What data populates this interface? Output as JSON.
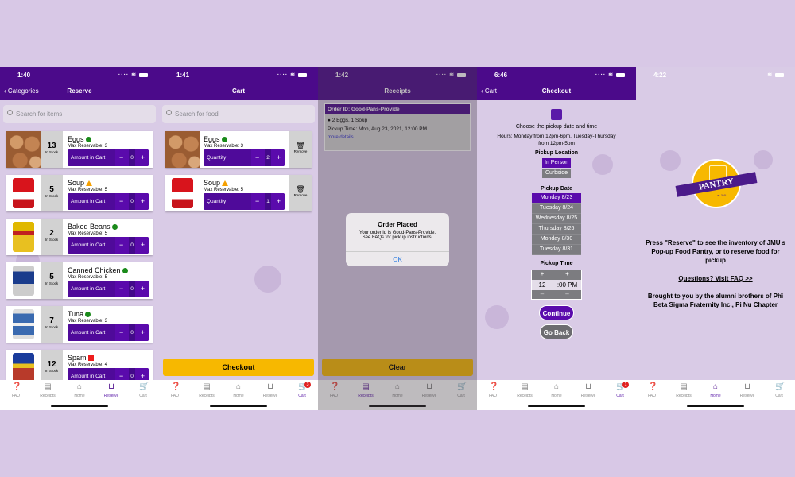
{
  "colors": {
    "brand": "#4b0a8a",
    "accent": "#f7b800",
    "background": "#d8c8e6",
    "available": "#1a8a1a",
    "low": "#f5a000",
    "out": "#ee1c1c"
  },
  "tabs": [
    {
      "label": "FAQ",
      "icon": "question-icon"
    },
    {
      "label": "Receipts",
      "icon": "receipt-icon"
    },
    {
      "label": "Home",
      "icon": "home-icon"
    },
    {
      "label": "Reserve",
      "icon": "basket-icon"
    },
    {
      "label": "Cart",
      "icon": "cart-icon"
    }
  ],
  "screen1": {
    "time": "1:40",
    "back": "Categories",
    "title": "Reserve",
    "search_placeholder": "Search for items",
    "stepper_label": "Amount in Cart",
    "in_stock_label": "In Stock",
    "items": [
      {
        "name": "Eggs",
        "stock": "13",
        "max": "Max Reservable: 3",
        "qty": "0",
        "status": "available"
      },
      {
        "name": "Soup",
        "stock": "5",
        "max": "Max Reservable: 5",
        "qty": "0",
        "status": "low"
      },
      {
        "name": "Baked Beans",
        "stock": "2",
        "max": "Max Reservable: 5",
        "qty": "0",
        "status": "available"
      },
      {
        "name": "Canned Chicken",
        "stock": "5",
        "max": "Max Reservable: 5",
        "qty": "0",
        "status": "available"
      },
      {
        "name": "Tuna",
        "stock": "7",
        "max": "Max Reservable: 3",
        "qty": "0",
        "status": "available"
      },
      {
        "name": "Spam",
        "stock": "12",
        "max": "Max Reservable: 4",
        "qty": "0",
        "status": "out"
      }
    ],
    "active_tab": "Reserve"
  },
  "screen2": {
    "time": "1:41",
    "title": "Cart",
    "search_placeholder": "Search for food",
    "stepper_label": "Quantity",
    "remove_label": "Remove",
    "items": [
      {
        "name": "Eggs",
        "max": "Max Reservable: 3",
        "qty": "2",
        "status": "available"
      },
      {
        "name": "Soup",
        "max": "Max Reservable: 5",
        "qty": "1",
        "status": "low"
      }
    ],
    "checkout_label": "Checkout",
    "cart_badge": "3",
    "active_tab": "Cart"
  },
  "screen3": {
    "time": "1:42",
    "title": "Receipts",
    "order_id": "Order ID: Good-Pans-Provide",
    "items": "2 Eggs, 1 Soup",
    "pickup": "Pickup Time:  Mon, Aug 23, 2021, 12:00 PM",
    "more": "more details...",
    "alert": {
      "title": "Order Placed",
      "line1": "Your order id is Good-Pans-Provide.",
      "line2": "See FAQs for pickup instructions.",
      "ok": "OK"
    },
    "clear_label": "Clear",
    "active_tab": "Receipts"
  },
  "screen4": {
    "time": "6:46",
    "back": "Cart",
    "title": "Checkout",
    "prompt": "Choose the pickup date and time",
    "hours1": "Hours: Monday from 12pm-6pm, Tuesday-Thursday",
    "hours2": "from 12pm-5pm",
    "location_label": "Pickup Location",
    "locations": [
      "In Person",
      "Curbside"
    ],
    "date_label": "Pickup Date",
    "dates": [
      "Monday 8/23",
      "Tuesday 8/24",
      "Wednesday 8/25",
      "Thursday 8/26",
      "Monday 8/30",
      "Tuesday 8/31"
    ],
    "time_label": "Pickup Time",
    "hour": "12",
    "minute": ":00 PM",
    "continue": "Continue",
    "go_back": "Go Back",
    "cart_badge": "1",
    "active_tab": "Cart"
  },
  "screen5": {
    "time": "4:22",
    "logo_text": {
      "the": "THE",
      "name": "PANTRY",
      "at": "at JMU",
      "ring": "The Union · Taylor Down Under 112"
    },
    "press": "Press ",
    "reserve_link": "\"Reserve\"",
    "intro_rest": " to see the inventory of JMU's Pop-up Food Pantry, or to reserve food for pickup",
    "faq_link": "Questions? Visit FAQ >>",
    "credit": "Brought to you by the alumni brothers of Phi Beta Sigma Fraternity Inc., Pi Nu Chapter",
    "active_tab": "Home"
  }
}
